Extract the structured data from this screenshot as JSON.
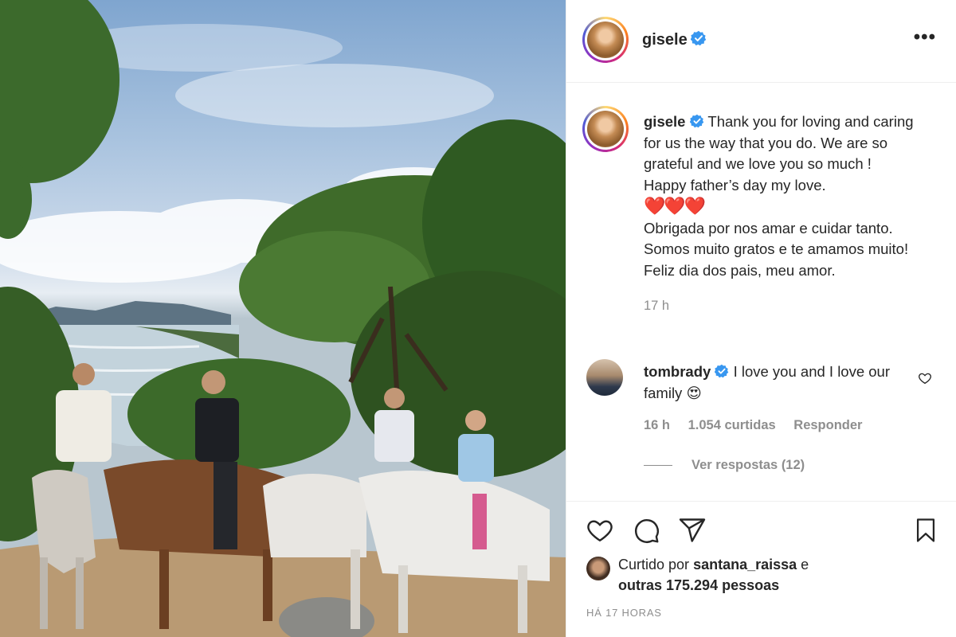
{
  "post": {
    "username": "gisele",
    "more_icon": "more-horizontal-icon"
  },
  "caption": {
    "username": "gisele",
    "text_en": "Thank you for loving and caring for us the way that you do. We are so grateful and we love you so much ! Happy father’s day my love.",
    "hearts": "❤️❤️❤️",
    "text_pt": "Obrigada por nos amar e cuidar tanto. Somos muito gratos e te amamos muito! Feliz dia dos pais, meu amor.",
    "time": "17 h"
  },
  "comment": {
    "username": "tombrady",
    "text": "I love you and I love our family",
    "emoji": "😍",
    "time": "16 h",
    "likes": "1.054 curtidas",
    "reply_label": "Responder",
    "view_replies": "Ver respostas (12)"
  },
  "actions": {
    "like_icon": "heart-icon",
    "comment_icon": "comment-icon",
    "share_icon": "paper-plane-icon",
    "save_icon": "bookmark-icon"
  },
  "likes_summary": {
    "prefix": "Curtido por",
    "user": "santana_raissa",
    "connector": "e",
    "others": "outras 175.294 pessoas"
  },
  "timestamp": "HÁ 17 HORAS",
  "colors": {
    "verified": "#3897f0",
    "heart": "#e4182c",
    "meta_gray": "#8e8e8e",
    "text": "#262626"
  }
}
